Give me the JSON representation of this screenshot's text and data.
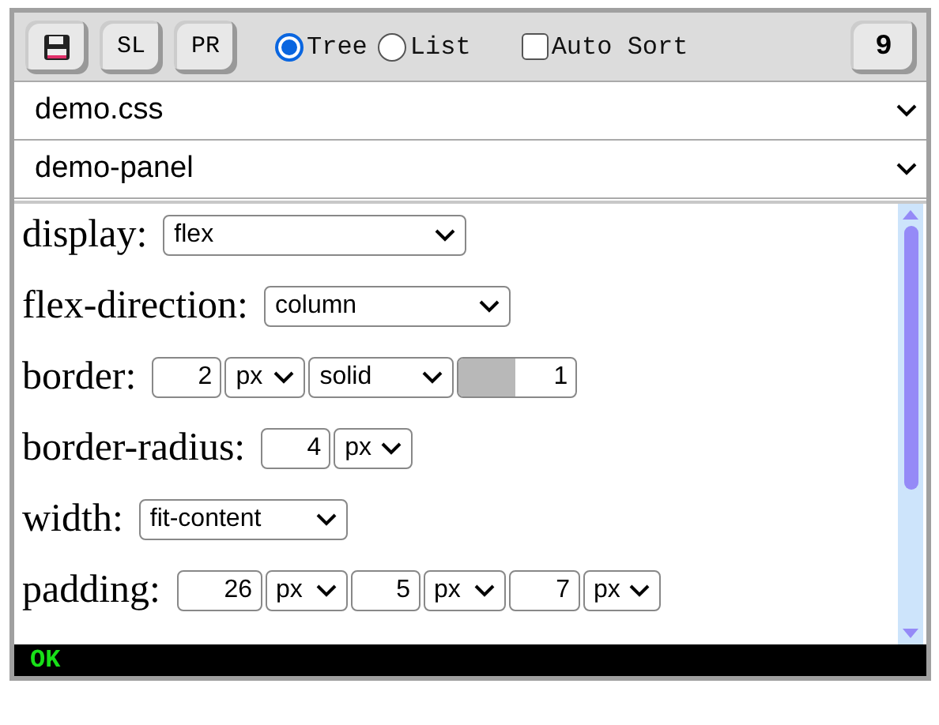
{
  "toolbar": {
    "buttons": [
      {
        "kind": "save"
      },
      {
        "kind": "text",
        "label": "SL"
      },
      {
        "kind": "text",
        "label": "PR"
      }
    ],
    "view_modes": [
      {
        "label": "Tree",
        "selected": true
      },
      {
        "label": "List",
        "selected": false
      }
    ],
    "auto_sort": {
      "label": "Auto Sort",
      "checked": false
    },
    "count": "9"
  },
  "stylesheet_select": {
    "value": "demo.css"
  },
  "element_select": {
    "value": "demo-panel"
  },
  "properties": [
    {
      "name": "display:",
      "parts": [
        {
          "kind": "select",
          "value": "flex"
        }
      ]
    },
    {
      "name": "flex-direction:",
      "parts": [
        {
          "kind": "select",
          "value": "column"
        }
      ]
    },
    {
      "name": "border:",
      "parts": [
        {
          "kind": "number",
          "value": "2"
        },
        {
          "kind": "select",
          "value": "px"
        },
        {
          "kind": "select",
          "value": "solid"
        },
        {
          "kind": "color",
          "color": "#b8b8b8",
          "value": "1"
        }
      ]
    },
    {
      "name": "border-radius:",
      "parts": [
        {
          "kind": "number",
          "value": "4"
        },
        {
          "kind": "select",
          "value": "px"
        }
      ]
    },
    {
      "name": "width:",
      "parts": [
        {
          "kind": "select",
          "value": "fit-content"
        }
      ]
    },
    {
      "name": "padding:",
      "parts": [
        {
          "kind": "number",
          "value": "26"
        },
        {
          "kind": "select",
          "value": "px"
        },
        {
          "kind": "number",
          "value": "5"
        },
        {
          "kind": "select",
          "value": "px"
        },
        {
          "kind": "number",
          "value": "7"
        },
        {
          "kind": "select",
          "value": "px"
        }
      ]
    }
  ],
  "status": {
    "text": "OK"
  }
}
